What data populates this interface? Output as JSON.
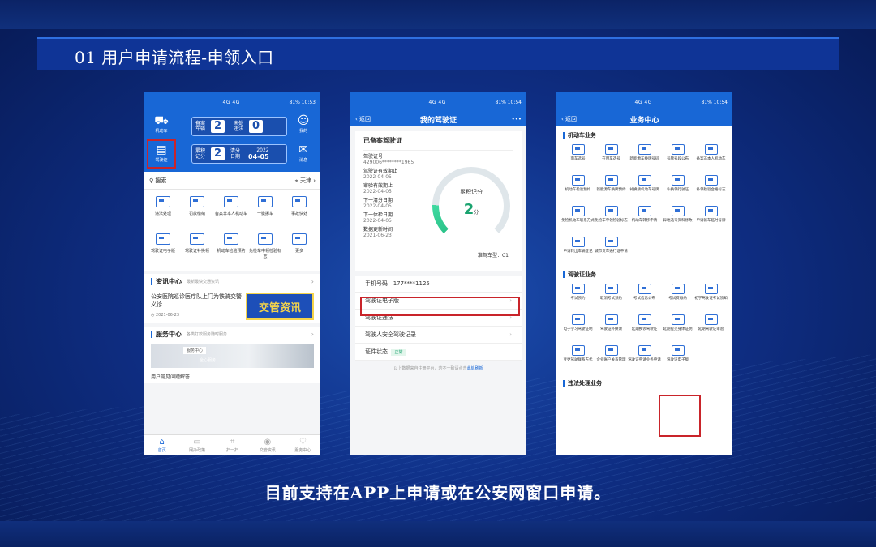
{
  "slide": {
    "title": "01 用户申请流程-申领入口",
    "caption": "目前支持在APP上申请或在公安网窗口申请。"
  },
  "phone1": {
    "status": {
      "center": "4G 4G",
      "right": "81% 10:53"
    },
    "header": {
      "icon_left_top": "机动车",
      "icon_left_bottom": "驾驶证",
      "icon_right_top": "我的",
      "icon_right_bottom": "消息",
      "plate1": {
        "label": "备案车辆",
        "value": "2",
        "label2": "未处违法",
        "value2": "0"
      },
      "plate2": {
        "label": "累积记分",
        "value": "2",
        "label2": "清分日期",
        "year": "2022",
        "date": "04-05"
      }
    },
    "search": {
      "placeholder": "搜索",
      "city": "天津"
    },
    "grid": [
      "违法处理",
      "罚款缴纳",
      "备案非本人机动车",
      "一键挪车",
      "事故快处",
      "驾驶证电子版",
      "驾驶证补换领",
      "机动车检验预约",
      "免检车申领检验标志",
      "更多"
    ],
    "news": {
      "title": "资讯中心",
      "sub": "最新最快交通资讯",
      "headline": "公安医院巡诊医疗队上门为铁骑交警义诊",
      "date": "2021-06-23",
      "banner": "交管资讯"
    },
    "service": {
      "title": "服务中心",
      "sub": "各类打款服务随时服务",
      "img_label": "服务中心",
      "img_label2": "全心服务",
      "question": "用户常见问题解答"
    },
    "tabs": [
      "首页",
      "网办政策",
      "扫一扫",
      "交管资讯",
      "服务中心"
    ]
  },
  "phone2": {
    "status": {
      "center": "4G 4G",
      "right": "81% 10:54"
    },
    "back": "返回",
    "title": "我的驾驶证",
    "more": "•••",
    "card_title": "已备案驾驶证",
    "fields": [
      {
        "label": "驾驶证号",
        "value": "429006********1965"
      },
      {
        "label": "驾驶证有效期止",
        "value": "2022-04-05"
      },
      {
        "label": "审验有效期止",
        "value": "2022-04-05"
      },
      {
        "label": "下一清分日期",
        "value": "2022-04-05"
      },
      {
        "label": "下一体检日期",
        "value": "2022-04-05"
      },
      {
        "label": "数据更新时间",
        "value": "2021-06-23"
      }
    ],
    "gauge": {
      "label": "累积记分",
      "value": "2",
      "unit": "分",
      "fraction": 0.17
    },
    "class_label": "准驾车型：C1",
    "phone": {
      "label": "手机号码",
      "value": "177****1125"
    },
    "list": [
      "驾驶证电子版",
      "驾驶证违法",
      "驾驶人安全驾驶记录"
    ],
    "status_row": {
      "label": "证件状态",
      "badge": "正常"
    },
    "note": "以上数据来自注册平台，若不一致请点击",
    "note_link": "此处刷新"
  },
  "phone3": {
    "status": {
      "center": "4G 4G",
      "right": "81% 10:54"
    },
    "back": "返回",
    "title": "业务中心",
    "cat1": "机动车业务",
    "grid1": [
      "面车选号",
      "在用车选号",
      "新能源车换牌号码",
      "号牌号段公布",
      "备案非本人机动车",
      "机动车检验预约",
      "新能源车换牌预约",
      "补换领机动车号牌",
      "补换领行驶证",
      "补领检验合格标志",
      "免检机动车联系方式",
      "免检车申领检验标志",
      "机动车转移申请",
      "异地选号资料修改",
      "申请新车临时号牌",
      "申请转出车辆登记",
      "城市货车通行证申请"
    ],
    "cat2": "驾驶证业务",
    "grid2": [
      "考试预约",
      "取消考试预约",
      "考试信息公布",
      "考试费缴纳",
      "初学驾驶证考试须知",
      "电子学习驾驶证明",
      "驾驶证补换领",
      "延期换领驾驶证",
      "延期提交身体证明",
      "延期驾驶证审验",
      "变更驾驶联系方式",
      "企业账户关系管理",
      "驾驶证申请业务申请",
      "驾驶证电子版"
    ],
    "cat3": "违法处理业务"
  }
}
